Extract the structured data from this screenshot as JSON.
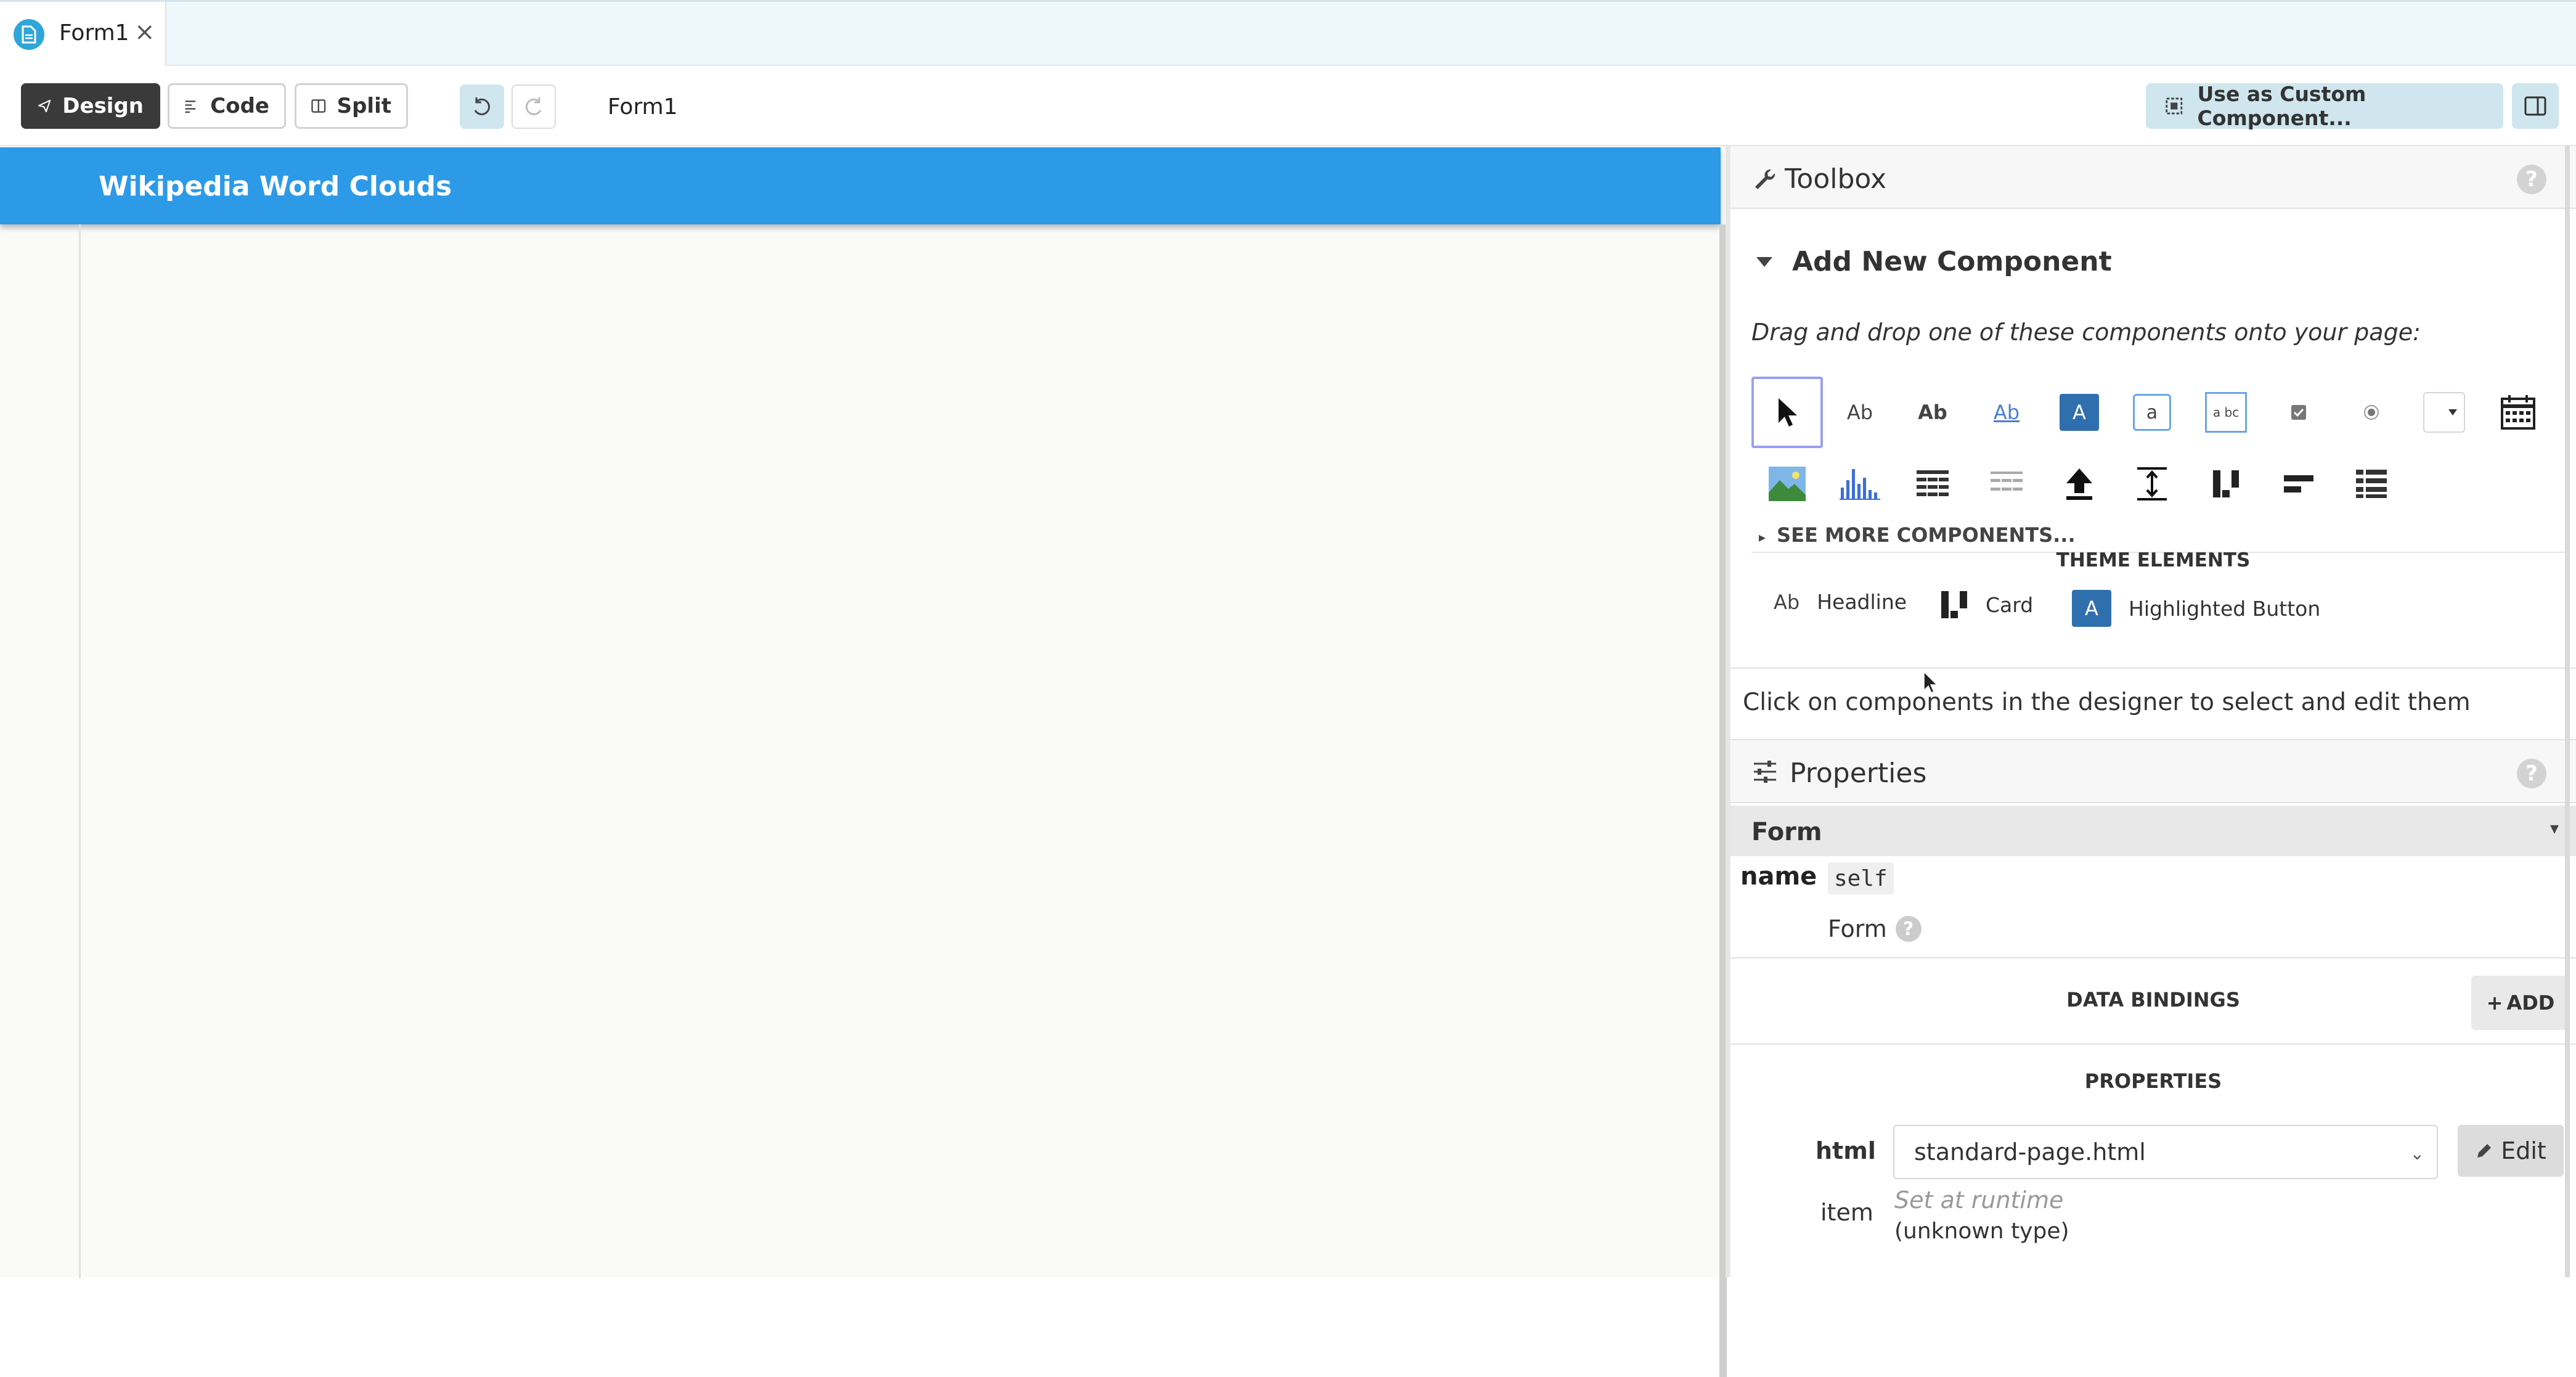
{
  "tab": {
    "label": "Form1",
    "close": "×"
  },
  "toolbar": {
    "design_label": "Design",
    "code_label": "Code",
    "split_label": "Split",
    "form_name": "Form1",
    "custom_component_label": "Use as Custom Component..."
  },
  "canvas": {
    "app_title": "Wikipedia Word Clouds"
  },
  "toolbox": {
    "title": "Toolbox",
    "help": "?",
    "add_new": "Add New Component",
    "drag_text": "Drag and drop one of these components onto your page:",
    "components_row1": [
      "pointer",
      "Ab",
      "Ab",
      "Ab",
      "A",
      "a",
      "a bc",
      "checkbox",
      "radio",
      "dropdown",
      "date-picker"
    ],
    "components_row2": [
      "image",
      "plot",
      "data-grid",
      "repeating-panel",
      "file-loader",
      "spacer",
      "column-panel",
      "flow-panel",
      "linear-panel"
    ],
    "see_more": "SEE MORE COMPONENTS...",
    "theme_title": "THEME ELEMENTS",
    "theme_items": [
      {
        "icon": "Ab",
        "label": "Headline"
      },
      {
        "icon": "card",
        "label": "Card"
      },
      {
        "icon": "A",
        "label": "Highlighted Button"
      }
    ],
    "click_hint": "Click on components in the designer to select and edit them"
  },
  "properties": {
    "title": "Properties",
    "help": "?",
    "form_header": "Form",
    "name_label": "name",
    "name_value": "self",
    "form_type": "Form",
    "data_bindings": "DATA BINDINGS",
    "add_label": "ADD",
    "properties_title": "PROPERTIES",
    "html_label": "html",
    "html_value": "standard-page.html",
    "edit_label": "Edit",
    "item_label": "item",
    "item_hint": "Set at runtime",
    "item_type": "(unknown type)"
  },
  "colors": {
    "header_blue": "#2d9ae8",
    "design_active": "#3a3a3a",
    "custom_btn": "#cfe6ee",
    "highlight_button": "#2f6fae"
  }
}
